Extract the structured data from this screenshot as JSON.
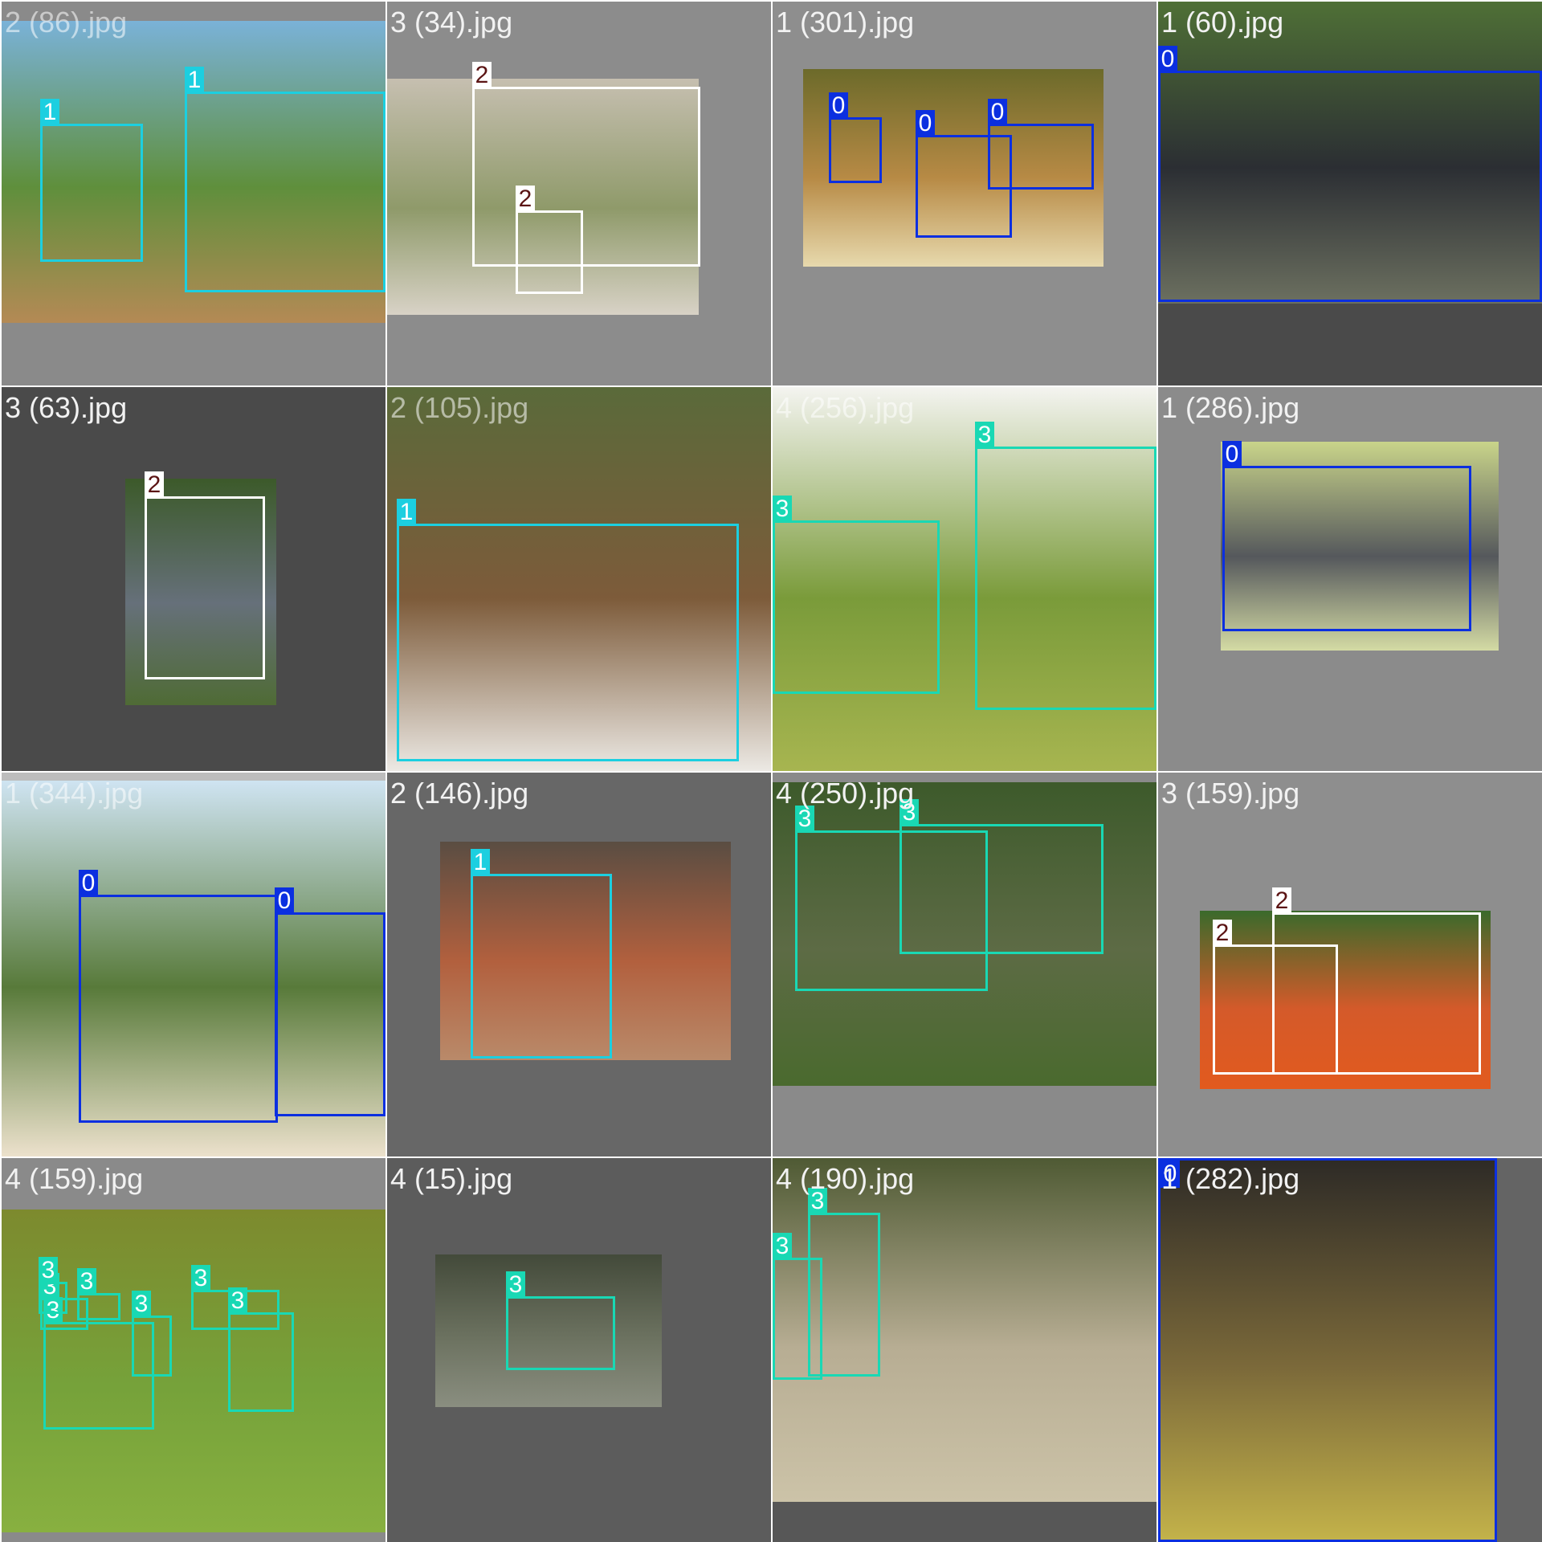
{
  "class_colors": {
    "0": "#0b2fe0",
    "1": "#1ccfe0",
    "2": "#ffffff",
    "3": "#19d8b4"
  },
  "label_text_colors": {
    "0": "#ffffff",
    "1": "#ffffff",
    "2": "#5b1414",
    "3": "#ffffff"
  },
  "tiles": [
    {
      "filename": "2 (86).jpg",
      "bg": "#8a8a8a",
      "photo_colors": [
        "#7ab2d8",
        "#5f8f3c",
        "#b48a55"
      ],
      "boxes": [
        {
          "label": "1"
        },
        {
          "label": "1"
        }
      ]
    },
    {
      "filename": "3 (34).jpg",
      "bg": "#8c8c8c",
      "photo_colors": [
        "#c6bfb0",
        "#8f9a6a",
        "#d8d2c6"
      ],
      "boxes": [
        {
          "label": "2"
        },
        {
          "label": "2"
        }
      ]
    },
    {
      "filename": "1 (301).jpg",
      "bg": "#8e8e8e",
      "photo_colors": [
        "#6c6a2a",
        "#b78a45",
        "#e7d9ad"
      ],
      "boxes": [
        {
          "label": "0"
        },
        {
          "label": "0"
        },
        {
          "label": "0"
        }
      ]
    },
    {
      "filename": "1 (60).jpg",
      "bg": "#4a4a4a",
      "photo_colors": [
        "#4f7036",
        "#2b2e33",
        "#6c7060"
      ],
      "boxes": [
        {
          "label": "0"
        }
      ]
    },
    {
      "filename": "3 (63).jpg",
      "bg": "#4a4a4a",
      "photo_colors": [
        "#3c5a2a",
        "#66707a",
        "#4f6b35"
      ],
      "boxes": [
        {
          "label": "2"
        }
      ]
    },
    {
      "filename": "2 (105).jpg",
      "bg": "#5d5d5d",
      "photo_colors": [
        "#5a6a3a",
        "#7d5b3a",
        "#ece9e4"
      ],
      "boxes": [
        {
          "label": "1"
        }
      ]
    },
    {
      "filename": "4 (256).jpg",
      "bg": "#ececec",
      "photo_colors": [
        "#f4f4f0",
        "#7a9b3a",
        "#a7b550"
      ],
      "boxes": [
        {
          "label": "3"
        },
        {
          "label": "3"
        }
      ]
    },
    {
      "filename": "1 (286).jpg",
      "bg": "#8b8b8b",
      "photo_colors": [
        "#c9d48a",
        "#55585c",
        "#d4dba4"
      ],
      "boxes": [
        {
          "label": "0"
        }
      ]
    },
    {
      "filename": "1 (344).jpg",
      "bg": "#bdbdbd",
      "photo_colors": [
        "#cfe4f2",
        "#587a3a",
        "#ece1cc"
      ],
      "boxes": [
        {
          "label": "0"
        },
        {
          "label": "0"
        }
      ]
    },
    {
      "filename": "2 (146).jpg",
      "bg": "#676767",
      "photo_colors": [
        "#5a4d42",
        "#b2603e",
        "#b98a6a"
      ],
      "boxes": [
        {
          "label": "1"
        }
      ]
    },
    {
      "filename": "4 (250).jpg",
      "bg": "#8a8a8a",
      "photo_colors": [
        "#3d5a2b",
        "#5d6b45",
        "#4a6a2e"
      ],
      "boxes": [
        {
          "label": "3"
        },
        {
          "label": "3"
        }
      ]
    },
    {
      "filename": "3 (159).jpg",
      "bg": "#8e8e8e",
      "photo_colors": [
        "#3a6a2b",
        "#d45a2a",
        "#e25a1e"
      ],
      "boxes": [
        {
          "label": "2"
        },
        {
          "label": "2"
        }
      ]
    },
    {
      "filename": "4 (159).jpg",
      "bg": "#8a8a8a",
      "photo_colors": [
        "#7d8a2e",
        "#76a23a",
        "#88b040"
      ],
      "boxes": [
        {
          "label": "3"
        },
        {
          "label": "3"
        },
        {
          "label": "3"
        },
        {
          "label": "3"
        },
        {
          "label": "3"
        },
        {
          "label": "3"
        },
        {
          "label": "3"
        }
      ]
    },
    {
      "filename": "4 (15).jpg",
      "bg": "#5c5c5c",
      "photo_colors": [
        "#434a3a",
        "#6c7260",
        "#8a8e80"
      ],
      "boxes": [
        {
          "label": "3"
        }
      ]
    },
    {
      "filename": "4 (190).jpg",
      "bg": "#575757",
      "photo_colors": [
        "#4f5a34",
        "#b7ad93",
        "#ccc3a8"
      ],
      "boxes": [
        {
          "label": "3"
        },
        {
          "label": "3"
        }
      ]
    },
    {
      "filename": "1 (282).jpg",
      "bg": "#646464",
      "photo_colors": [
        "#2d2a26",
        "#7c6a3a",
        "#c4b34a"
      ],
      "boxes": [
        {
          "label": "0"
        }
      ]
    }
  ]
}
